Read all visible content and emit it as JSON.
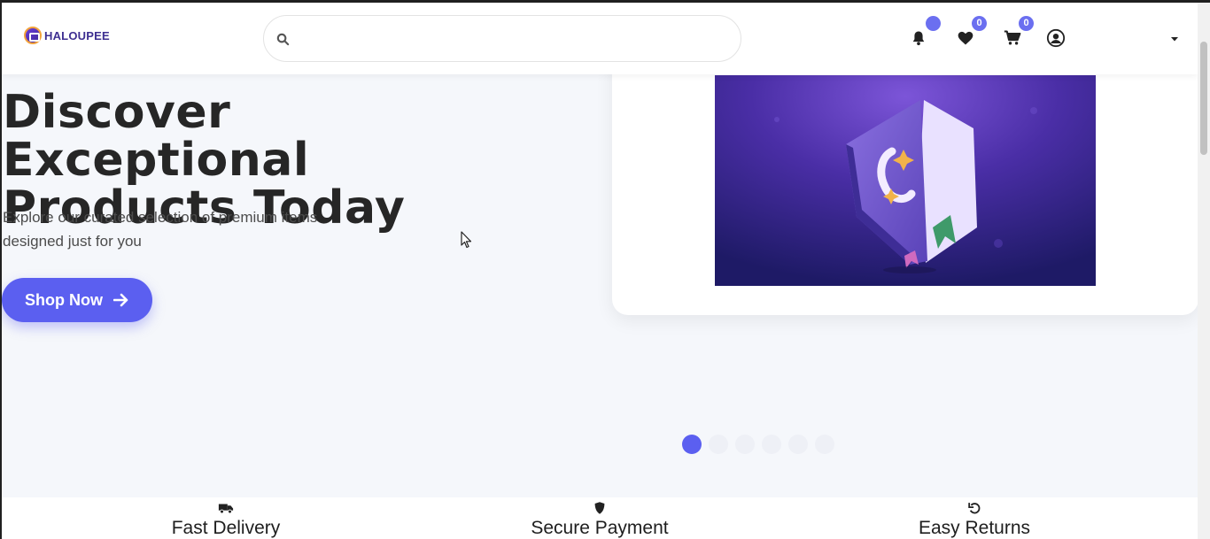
{
  "header": {
    "logo_text": "HALOUPEE",
    "search": {
      "value": "",
      "placeholder": ""
    },
    "wishlist_count": "0",
    "cart_count": "0"
  },
  "hero": {
    "title_line1": "Discover Exceptional",
    "title_line2": "Products Today",
    "subtitle": "Explore our curated selection of premium items designed just for you",
    "cta_label": "Shop Now"
  },
  "carousel": {
    "slide_count": 6,
    "active_index": 0
  },
  "features": [
    {
      "icon": "truck-icon",
      "label": "Fast Delivery"
    },
    {
      "icon": "shield-icon",
      "label": "Secure Payment"
    },
    {
      "icon": "undo-icon",
      "label": "Easy Returns"
    }
  ],
  "colors": {
    "accent": "#5b5ff0",
    "badge": "#6b6ff0",
    "hero_image_bg": "#3a2a90"
  }
}
